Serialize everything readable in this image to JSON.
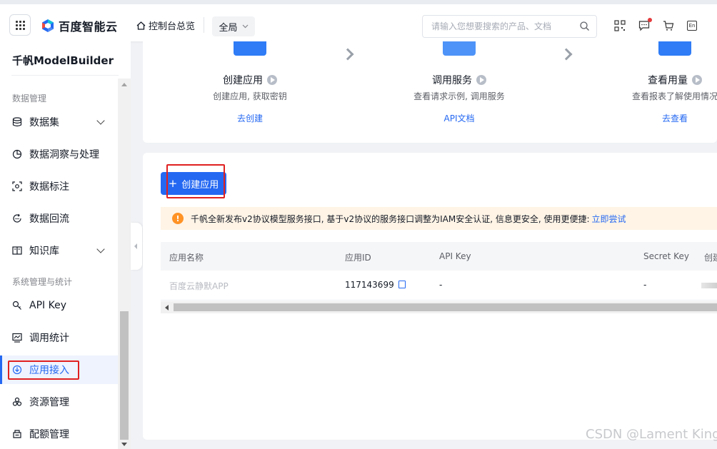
{
  "header": {
    "brand": "百度智能云",
    "console_label": "控制台总览",
    "region_label": "全局",
    "search_placeholder": "请输入您想要搜索的产品、文档",
    "lang_badge": "En"
  },
  "sidebar": {
    "title": "千帆ModelBuilder",
    "group_data": "数据管理",
    "group_system": "系统管理与统计",
    "items": [
      {
        "label": "数据集",
        "icon": "database-icon",
        "expandable": true
      },
      {
        "label": "数据洞察与处理",
        "icon": "pie-chart-icon"
      },
      {
        "label": "数据标注",
        "icon": "scan-icon"
      },
      {
        "label": "数据回流",
        "icon": "refresh-icon"
      },
      {
        "label": "知识库",
        "icon": "book-icon",
        "expandable": true
      },
      {
        "label": "API Key",
        "icon": "key-icon"
      },
      {
        "label": "调用统计",
        "icon": "monitor-chart-icon"
      },
      {
        "label": "应用接入",
        "icon": "download-circle-icon",
        "active": true
      },
      {
        "label": "资源管理",
        "icon": "resource-icon"
      },
      {
        "label": "配额管理",
        "icon": "quota-icon"
      }
    ]
  },
  "steps": [
    {
      "title": "创建应用",
      "desc": "创建应用, 获取密钥",
      "link": "去创建"
    },
    {
      "title": "调用服务",
      "desc": "查看请求示例, 调用服务",
      "link": "API文档"
    },
    {
      "title": "查看用量",
      "desc": "查看报表了解使用情况",
      "link": "去查看"
    }
  ],
  "main": {
    "create_button": "创建应用",
    "notice_text": "千帆全新发布v2协议模型服务接口, 基于v2协议的服务接口调整为IAM安全认证, 信息更安全, 使用更便捷:",
    "notice_link": "立即尝试",
    "table": {
      "columns": [
        "应用名称",
        "应用ID",
        "API Key",
        "Secret Key",
        "创建"
      ],
      "rows": [
        {
          "name": "百度云静默APP",
          "id": "117143699",
          "api_key": "-",
          "secret_key": "-"
        }
      ]
    }
  },
  "watermark": "CSDN @Lament King",
  "colors": {
    "accent": "#2468f2",
    "highlight": "#e02020",
    "warning": "#ff9326"
  }
}
